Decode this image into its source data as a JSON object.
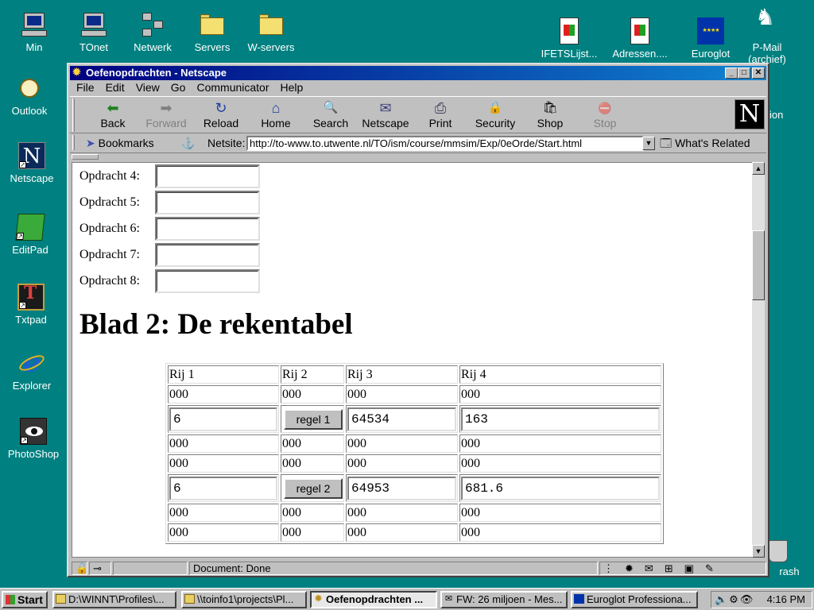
{
  "desktop": {
    "left_icons": [
      {
        "label": "Min",
        "icon": "computer-icon"
      },
      {
        "label": "Outlook",
        "icon": "outlook-icon"
      },
      {
        "label": "Netscape",
        "icon": "netscape-icon"
      },
      {
        "label": "EditPad",
        "icon": "editpad-icon"
      },
      {
        "label": "Txtpad",
        "icon": "txtpad-icon"
      },
      {
        "label": "Explorer",
        "icon": "internet-explorer-icon"
      },
      {
        "label": "PhotoShop",
        "icon": "photoshop-icon"
      }
    ],
    "top_icons": [
      {
        "label": "TOnet",
        "icon": "computer-icon"
      },
      {
        "label": "Netwerk",
        "icon": "network-icon"
      },
      {
        "label": "Servers",
        "icon": "folder-icon"
      },
      {
        "label": "W-servers",
        "icon": "folder-icon"
      }
    ],
    "right_icons": [
      {
        "label": "IFETSLijst...",
        "icon": "document-icon"
      },
      {
        "label": "Adressen....",
        "icon": "document-icon"
      },
      {
        "label": "Euroglot",
        "icon": "euroglot-icon"
      },
      {
        "label": "P-Mail (archief)",
        "icon": "pmail-icon"
      }
    ],
    "partial_labels": {
      "behind_window_right": "ion",
      "trash": "rash"
    }
  },
  "window": {
    "title": "Oefenopdrachten - Netscape",
    "controls": {
      "minimize": "_",
      "maximize": "□",
      "close": "✕"
    },
    "menu": [
      "File",
      "Edit",
      "View",
      "Go",
      "Communicator",
      "Help"
    ],
    "toolbar": [
      {
        "label": "Back",
        "glyph": "⬅",
        "enabled": true
      },
      {
        "label": "Forward",
        "glyph": "➡",
        "enabled": false
      },
      {
        "label": "Reload",
        "glyph": "↻",
        "enabled": true
      },
      {
        "label": "Home",
        "glyph": "⌂",
        "enabled": true
      },
      {
        "label": "Search",
        "glyph": "🔍",
        "enabled": true
      },
      {
        "label": "Netscape",
        "glyph": "✉",
        "enabled": true
      },
      {
        "label": "Print",
        "glyph": "⎙",
        "enabled": true
      },
      {
        "label": "Security",
        "glyph": "🔒",
        "enabled": true
      },
      {
        "label": "Shop",
        "glyph": "🛍",
        "enabled": true
      },
      {
        "label": "Stop",
        "glyph": "⛔",
        "enabled": false
      }
    ],
    "location": {
      "bookmarks_label": "Bookmarks",
      "netsite_label": "Netsite:",
      "url": "http://to-www.to.utwente.nl/TO/ism/course/mmsim/Exp/0eOrde/Start.html",
      "related_label": "What's Related"
    },
    "page": {
      "opdrachten": [
        {
          "label": "Opdracht 4:",
          "value": ""
        },
        {
          "label": "Opdracht 5:",
          "value": ""
        },
        {
          "label": "Opdracht 6:",
          "value": ""
        },
        {
          "label": "Opdracht 7:",
          "value": ""
        },
        {
          "label": "Opdracht 8:",
          "value": ""
        }
      ],
      "heading": "Blad 2: De rekentabel",
      "table": {
        "headers": [
          "Rij 1",
          "Rij 2",
          "Rij 3",
          "Rij 4"
        ],
        "rows": [
          {
            "type": "text",
            "cells": [
              "000",
              "000",
              "000",
              "000"
            ]
          },
          {
            "type": "input",
            "inputs": [
              "6",
              "64534",
              "163"
            ],
            "button": "regel 1"
          },
          {
            "type": "text",
            "cells": [
              "000",
              "000",
              "000",
              "000"
            ]
          },
          {
            "type": "text",
            "cells": [
              "000",
              "000",
              "000",
              "000"
            ]
          },
          {
            "type": "input",
            "inputs": [
              "6",
              "64953",
              "681.6"
            ],
            "button": "regel 2"
          },
          {
            "type": "text",
            "cells": [
              "000",
              "000",
              "000",
              "000"
            ]
          },
          {
            "type": "text",
            "cells": [
              "000",
              "000",
              "000",
              "000"
            ]
          }
        ]
      }
    },
    "status": "Document: Done"
  },
  "taskbar": {
    "start": "Start",
    "tasks": [
      {
        "label": "D:\\WINNT\\Profiles\\...",
        "icon": "folder-icon",
        "active": false
      },
      {
        "label": "\\\\toinfo1\\projects\\Pl...",
        "icon": "folder-icon",
        "active": false
      },
      {
        "label": "Oefenopdrachten ...",
        "icon": "netscape-icon",
        "active": true
      },
      {
        "label": "FW: 26 miljoen - Mes...",
        "icon": "mail-icon",
        "active": false
      },
      {
        "label": "Euroglot Professiona...",
        "icon": "euroglot-icon",
        "active": false
      }
    ],
    "clock": "4:16 PM"
  },
  "colors": {
    "desktop": "#008080",
    "titlebar": "#000080",
    "chrome": "#c0c0c0"
  }
}
